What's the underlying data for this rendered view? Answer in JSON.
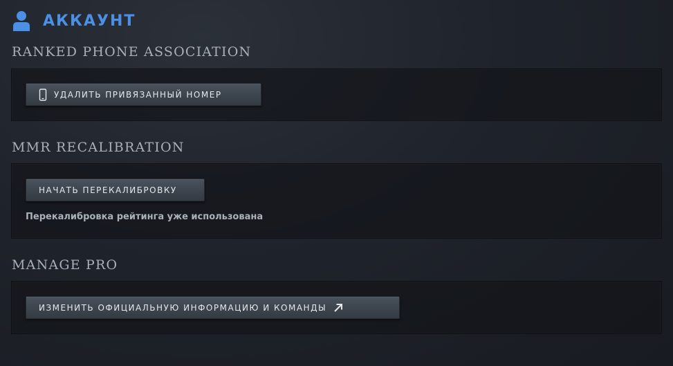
{
  "header": {
    "title": "АККАУНТ",
    "icon": "user-icon",
    "accent_color": "#4b90e4"
  },
  "sections": {
    "ranked_phone": {
      "title": "RANKED PHONE ASSOCIATION",
      "button_label": "УДАЛИТЬ ПРИВЯЗАННЫЙ НОМЕР",
      "button_icon": "phone-icon"
    },
    "mmr_recalibration": {
      "title": "MMR RECALIBRATION",
      "button_label": "НАЧАТЬ ПЕРЕКАЛИБРОВКУ",
      "status_text": "Перекалибровка рейтинга уже использована"
    },
    "manage_pro": {
      "title": "MANAGE PRO",
      "button_label": "ИЗМЕНИТЬ ОФИЦИАЛЬНУЮ ИНФОРМАЦИЮ И КОМАНДЫ",
      "button_icon": "external-link-arrow-icon"
    }
  }
}
